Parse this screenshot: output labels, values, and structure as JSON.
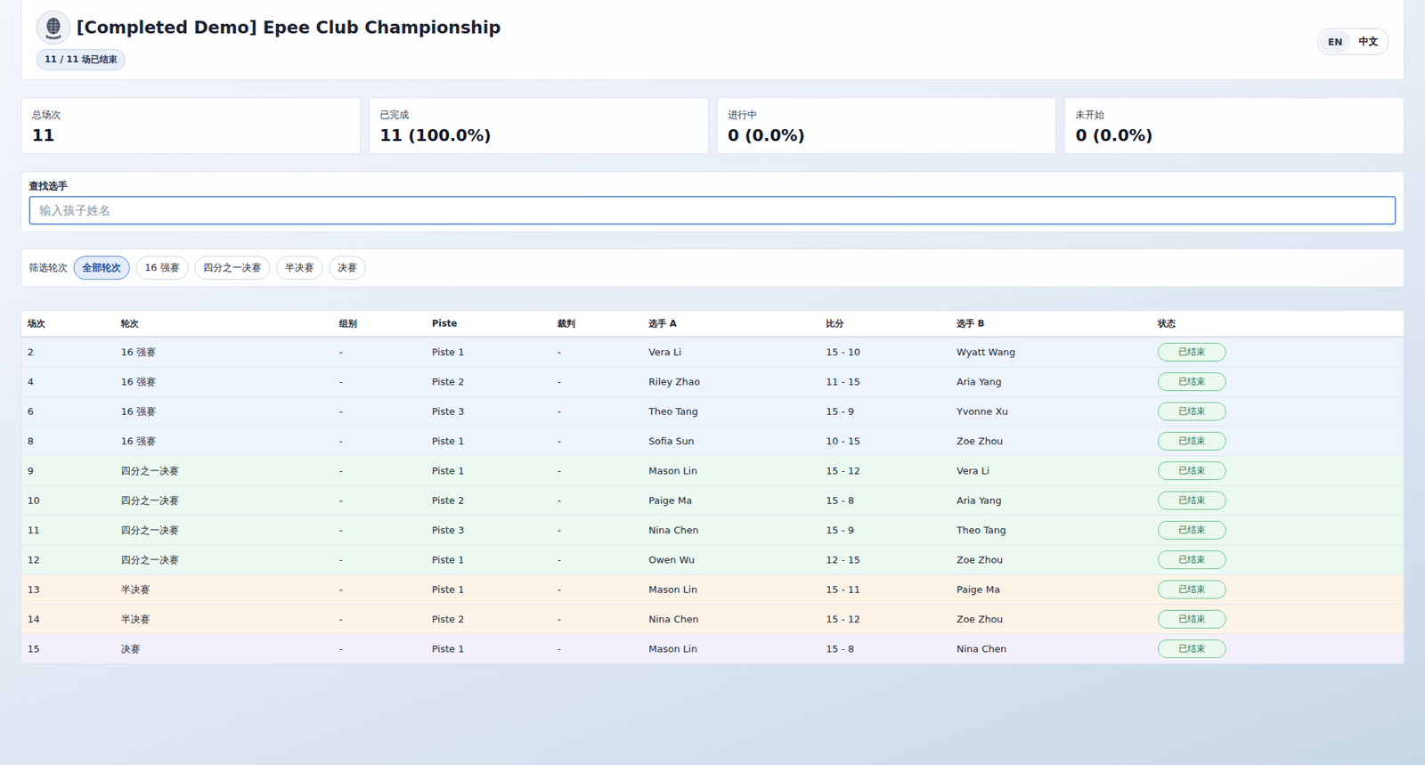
{
  "header": {
    "title": "[Completed Demo] Epee Club Championship",
    "badge": "11 / 11 场已结束"
  },
  "languages": [
    {
      "label": "EN",
      "selected": false
    },
    {
      "label": "中文",
      "selected": true
    }
  ],
  "stats": [
    {
      "label": "总场次",
      "value": "11"
    },
    {
      "label": "已完成",
      "value": "11 (100.0%)"
    },
    {
      "label": "进行中",
      "value": "0 (0.0%)"
    },
    {
      "label": "未开始",
      "value": "0 (0.0%)"
    }
  ],
  "search": {
    "label": "查找选手",
    "placeholder": "输入孩子姓名"
  },
  "filter": {
    "label": "筛选轮次",
    "chips": [
      {
        "label": "全部轮次",
        "selected": true
      },
      {
        "label": "16 强赛",
        "selected": false
      },
      {
        "label": "四分之一决赛",
        "selected": false
      },
      {
        "label": "半决赛",
        "selected": false
      },
      {
        "label": "决赛",
        "selected": false
      }
    ]
  },
  "table": {
    "columns": [
      "场次",
      "轮次",
      "组别",
      "Piste",
      "裁判",
      "选手 A",
      "比分",
      "选手 B",
      "状态"
    ],
    "rows": [
      {
        "match": "2",
        "round": "16 强赛",
        "group": "-",
        "piste": "Piste 1",
        "referee": "-",
        "a": "Vera Li",
        "score": "15 - 10",
        "b": "Wyatt Wang",
        "status": "已结束",
        "color": "#edf4fc"
      },
      {
        "match": "4",
        "round": "16 强赛",
        "group": "-",
        "piste": "Piste 2",
        "referee": "-",
        "a": "Riley Zhao",
        "score": "11 - 15",
        "b": "Aria Yang",
        "status": "已结束",
        "color": "#edf4fc"
      },
      {
        "match": "6",
        "round": "16 强赛",
        "group": "-",
        "piste": "Piste 3",
        "referee": "-",
        "a": "Theo Tang",
        "score": "15 - 9",
        "b": "Yvonne Xu",
        "status": "已结束",
        "color": "#edf4fc"
      },
      {
        "match": "8",
        "round": "16 强赛",
        "group": "-",
        "piste": "Piste 1",
        "referee": "-",
        "a": "Sofia Sun",
        "score": "10 - 15",
        "b": "Zoe Zhou",
        "status": "已结束",
        "color": "#edf4fc"
      },
      {
        "match": "9",
        "round": "四分之一决赛",
        "group": "-",
        "piste": "Piste 1",
        "referee": "-",
        "a": "Mason Lin",
        "score": "15 - 12",
        "b": "Vera Li",
        "status": "已结束",
        "color": "#ecf9f1"
      },
      {
        "match": "10",
        "round": "四分之一决赛",
        "group": "-",
        "piste": "Piste 2",
        "referee": "-",
        "a": "Paige Ma",
        "score": "15 - 8",
        "b": "Aria Yang",
        "status": "已结束",
        "color": "#ecf9f1"
      },
      {
        "match": "11",
        "round": "四分之一决赛",
        "group": "-",
        "piste": "Piste 3",
        "referee": "-",
        "a": "Nina Chen",
        "score": "15 - 9",
        "b": "Theo Tang",
        "status": "已结束",
        "color": "#ecf9f1"
      },
      {
        "match": "12",
        "round": "四分之一决赛",
        "group": "-",
        "piste": "Piste 1",
        "referee": "-",
        "a": "Owen Wu",
        "score": "12 - 15",
        "b": "Zoe Zhou",
        "status": "已结束",
        "color": "#ecf9f1"
      },
      {
        "match": "13",
        "round": "半决赛",
        "group": "-",
        "piste": "Piste 1",
        "referee": "-",
        "a": "Mason Lin",
        "score": "15 - 11",
        "b": "Paige Ma",
        "status": "已结束",
        "color": "#fdf3e7"
      },
      {
        "match": "14",
        "round": "半决赛",
        "group": "-",
        "piste": "Piste 2",
        "referee": "-",
        "a": "Nina Chen",
        "score": "15 - 12",
        "b": "Zoe Zhou",
        "status": "已结束",
        "color": "#fdf3e7"
      },
      {
        "match": "15",
        "round": "决赛",
        "group": "-",
        "piste": "Piste 1",
        "referee": "-",
        "a": "Mason Lin",
        "score": "15 - 8",
        "b": "Nina Chen",
        "status": "已结束",
        "color": "#f3f0fb"
      }
    ]
  }
}
